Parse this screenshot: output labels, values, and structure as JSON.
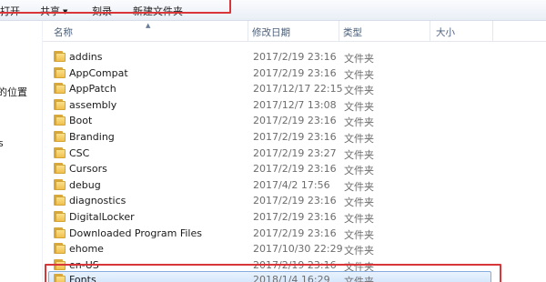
{
  "toolbar": {
    "open_label": "打开",
    "share_label": "共享",
    "burn_label": "刻录",
    "new_folder_label": "新建文件夹"
  },
  "nav": {
    "items": [
      {
        "label": "的位置"
      },
      {
        "label": "s"
      }
    ]
  },
  "columns": {
    "name": "名称",
    "date": "修改日期",
    "type": "类型",
    "size": "大小"
  },
  "rows": [
    {
      "name": "addins",
      "date": "2017/2/19 23:16",
      "type": "文件夹"
    },
    {
      "name": "AppCompat",
      "date": "2017/2/19 23:16",
      "type": "文件夹"
    },
    {
      "name": "AppPatch",
      "date": "2017/12/17 22:15",
      "type": "文件夹"
    },
    {
      "name": "assembly",
      "date": "2017/12/7 13:08",
      "type": "文件夹"
    },
    {
      "name": "Boot",
      "date": "2017/2/19 23:16",
      "type": "文件夹"
    },
    {
      "name": "Branding",
      "date": "2017/2/19 23:16",
      "type": "文件夹"
    },
    {
      "name": "CSC",
      "date": "2017/2/19 23:27",
      "type": "文件夹"
    },
    {
      "name": "Cursors",
      "date": "2017/2/19 23:16",
      "type": "文件夹"
    },
    {
      "name": "debug",
      "date": "2017/4/2 17:56",
      "type": "文件夹"
    },
    {
      "name": "diagnostics",
      "date": "2017/2/19 23:16",
      "type": "文件夹"
    },
    {
      "name": "DigitalLocker",
      "date": "2017/2/19 23:16",
      "type": "文件夹"
    },
    {
      "name": "Downloaded Program Files",
      "date": "2017/2/19 23:16",
      "type": "文件夹"
    },
    {
      "name": "ehome",
      "date": "2017/10/30 22:29",
      "type": "文件夹"
    },
    {
      "name": "en-US",
      "date": "2017/2/19 23:16",
      "type": "文件夹"
    },
    {
      "name": "Fonts",
      "date": "2018/1/4 16:29",
      "type": "文件夹"
    }
  ],
  "colors": {
    "highlight_box": "#d9363a",
    "selection": "#cde4fb",
    "folder": "#f0c04e"
  }
}
